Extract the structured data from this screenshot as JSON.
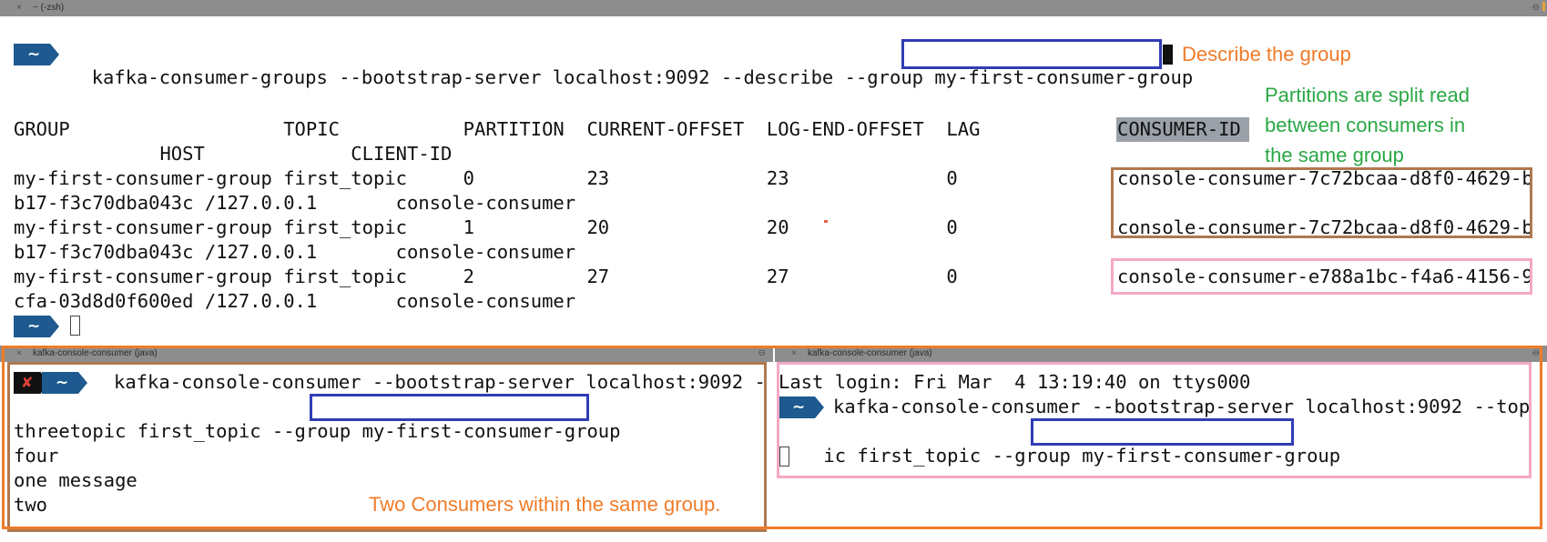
{
  "colors": {
    "title_bar": "#8d8d8d",
    "prompt_blue": "#1e5a8f",
    "highlight_blue": "#2f3db5",
    "highlight_brown": "#b07850",
    "highlight_pink": "#f4a8c6",
    "annotation_orange": "#f07b28",
    "annotation_green": "#2aa845",
    "consumer_id_bg": "#9aa1a8"
  },
  "top_window": {
    "title": "~ (-zsh)",
    "close_icon": "×",
    "right_icon": "⊖",
    "prompt_symbol": "~",
    "command_prefix": "kafka-consumer-groups --bootstrap-server localhost:9092 --describe --group ",
    "command_group": "my-first-consumer-group",
    "header_line1": "GROUP                   TOPIC           PARTITION  CURRENT-OFFSET  LOG-END-OFFSET  LAG",
    "header_consumer_id": "CONSUMER-ID",
    "header_line2": "             HOST             CLIENT-ID",
    "rows": [
      {
        "line": "my-first-consumer-group first_topic     0          23              23              0",
        "consumer_id": "console-consumer-7c72bcaa-d8f0-4629-b",
        "cont": "b17-f3c70dba043c /127.0.0.1       console-consumer"
      },
      {
        "line": "my-first-consumer-group first_topic     1          20              20              0",
        "consumer_id": "console-consumer-7c72bcaa-d8f0-4629-b",
        "cont": "b17-f3c70dba043c /127.0.0.1       console-consumer"
      },
      {
        "line": "my-first-consumer-group first_topic     2          27              27              0",
        "consumer_id": "console-consumer-e788a1bc-f4a6-4156-9",
        "cont": "cfa-03d8d0f600ed /127.0.0.1       console-consumer"
      }
    ]
  },
  "annotations": {
    "describe": "Describe the group",
    "partitions_lines": [
      "Partitions are split read",
      "between consumers in",
      "the same group"
    ],
    "two_consumers": "Two Consumers within the same group."
  },
  "left_window": {
    "title": "kafka-console-consumer (java)",
    "close_icon": "×",
    "right_icon": "⊖",
    "err_symbol": "✘",
    "prompt_symbol": "~",
    "line1": "kafka-console-consumer --bootstrap-server localhost:9092 -",
    "line2_prefix": "-topic first_topic --group ",
    "line2_group": "my-first-consumer-group",
    "messages": [
      "three",
      "four",
      "one message",
      "two"
    ]
  },
  "right_window": {
    "title": "kafka-console-consumer (java)",
    "close_icon": "×",
    "right_icon": "⊖",
    "last_login": "Last login: Fri Mar  4 13:19:40 on ttys000",
    "prompt_symbol": "~",
    "line1": "kafka-console-consumer --bootstrap-server localhost:9092 --top",
    "line2_prefix": "ic first_topic --group ",
    "line2_group": "my-first-consumer-group"
  }
}
